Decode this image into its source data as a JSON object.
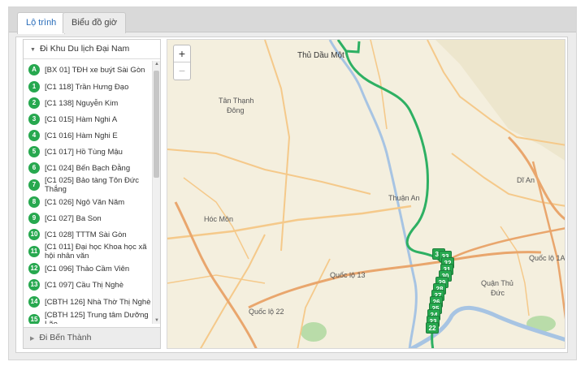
{
  "tabs": [
    {
      "label": "Lộ trình"
    },
    {
      "label": "Biểu đồ giờ"
    }
  ],
  "sidebar": {
    "route_header": "Đi Khu Du lịch Đại Nam",
    "route_footer": "Đi Bến Thành",
    "stops": [
      {
        "badge": "A",
        "label": "[BX 01] TĐH xe buýt Sài Gòn"
      },
      {
        "badge": "1",
        "label": "[C1 118] Trần Hưng Đạo"
      },
      {
        "badge": "2",
        "label": "[C1 138] Nguyễn Kim"
      },
      {
        "badge": "3",
        "label": "[C1 015] Hàm Nghi A"
      },
      {
        "badge": "4",
        "label": "[C1 016] Hàm Nghi E"
      },
      {
        "badge": "5",
        "label": "[C1 017] Hồ Tùng Mậu"
      },
      {
        "badge": "6",
        "label": "[C1 024] Bến Bạch Đằng"
      },
      {
        "badge": "7",
        "label": "[C1 025] Bảo tàng Tôn Đức Thắng"
      },
      {
        "badge": "8",
        "label": "[C1 026] Ngô Văn Năm"
      },
      {
        "badge": "9",
        "label": "[C1 027] Ba Son"
      },
      {
        "badge": "10",
        "label": "[C1 028] TTTM Sài Gòn"
      },
      {
        "badge": "11",
        "label": "[C1 011] Đại học Khoa học xã hội nhân văn"
      },
      {
        "badge": "12",
        "label": "[C1 096] Thảo Cầm Viên"
      },
      {
        "badge": "13",
        "label": "[C1 097] Cầu Thị Nghè"
      },
      {
        "badge": "14",
        "label": "[CBTH 126] Nhà Thờ Thị Nghè"
      },
      {
        "badge": "15",
        "label": "[CBTH 125] Trung tâm Dưỡng Lão"
      }
    ]
  },
  "map": {
    "zoom_in": "+",
    "zoom_out": "−",
    "labels": {
      "thu_dau_mot": "Thủ Dầu Một",
      "tan_thanh": "Tân Thạnh",
      "dong": "Đông",
      "thuan_an": "Thuận An",
      "hoc_mon": "Hóc Môn",
      "di_an": "Dĩ An",
      "quan_thu": "Quận Thủ",
      "duc": "Đức",
      "quoc_lo_13": "Quốc lộ 13",
      "quoc_lo_1a": "Quốc lộ 1A",
      "quoc_lo_22": "Quốc lộ 22"
    },
    "markers": [
      "34",
      "33",
      "32",
      "31",
      "30",
      "29",
      "28",
      "27",
      "26",
      "25",
      "24",
      "23",
      "22"
    ],
    "colors": {
      "route": "#2eb063",
      "marker": "#27a84f",
      "major_road": "#f5c98a",
      "highway": "#e9a66d",
      "water": "#a7c4e3",
      "park": "#b9dca9"
    }
  }
}
